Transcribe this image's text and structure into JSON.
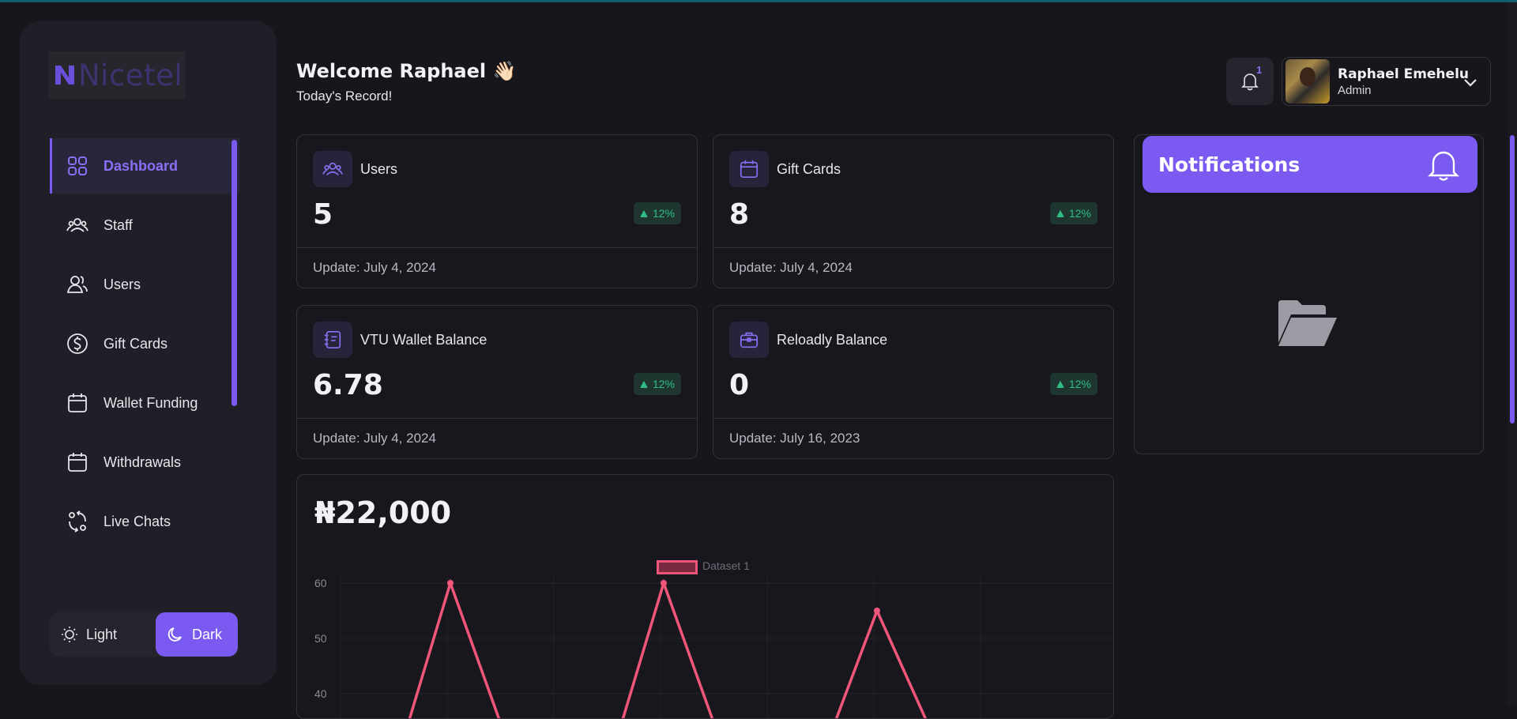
{
  "brand": {
    "name": "Nicetel"
  },
  "sidebar": {
    "items": [
      {
        "label": "Dashboard",
        "icon": "grid-icon",
        "active": true
      },
      {
        "label": "Staff",
        "icon": "team-icon"
      },
      {
        "label": "Users",
        "icon": "users-icon"
      },
      {
        "label": "Gift Cards",
        "icon": "dollar-circle-icon"
      },
      {
        "label": "Wallet Funding",
        "icon": "calendar-icon"
      },
      {
        "label": "Withdrawals",
        "icon": "calendar-icon"
      },
      {
        "label": "Live Chats",
        "icon": "chat-exchange-icon"
      }
    ],
    "theme": {
      "light_label": "Light",
      "dark_label": "Dark",
      "selected": "Dark"
    }
  },
  "header": {
    "welcome": "Welcome Raphael 👋🏻",
    "subtitle": "Today's Record!",
    "notification_count": "1",
    "user": {
      "name": "Raphael Emehelu",
      "role": "Admin"
    }
  },
  "cards": [
    {
      "title": "Users",
      "value": "5",
      "badge": "12%",
      "update": "Update: July 4, 2024",
      "icon": "team-icon"
    },
    {
      "title": "Gift Cards",
      "value": "8",
      "badge": "12%",
      "update": "Update: July 4, 2024",
      "icon": "calendar-icon"
    },
    {
      "title": "VTU Wallet Balance",
      "value": "6.78",
      "badge": "12%",
      "update": "Update: July 4, 2024",
      "icon": "ledger-icon"
    },
    {
      "title": "Reloadly Balance",
      "value": "0",
      "badge": "12%",
      "update": "Update: July 16, 2023",
      "icon": "briefcase-icon"
    }
  ],
  "notifications": {
    "title": "Notifications",
    "empty_icon": "folder-open-icon"
  },
  "chart": {
    "amount": "₦22,000",
    "y_ticks": [
      "60",
      "50",
      "40"
    ]
  },
  "chart_data": {
    "type": "line",
    "legend": [
      "Dataset 1"
    ],
    "series": [
      {
        "name": "Dataset 1",
        "color": "#f0567a",
        "points": [
          [
            1,
            60
          ],
          [
            2,
            60
          ],
          [
            3,
            55
          ]
        ]
      }
    ],
    "ylim": [
      40,
      60
    ],
    "ytick_labels": [
      "60",
      "50",
      "40"
    ]
  },
  "colors": {
    "accent": "#7a5af0",
    "success": "#2fbf84",
    "line": "#f0567a"
  }
}
